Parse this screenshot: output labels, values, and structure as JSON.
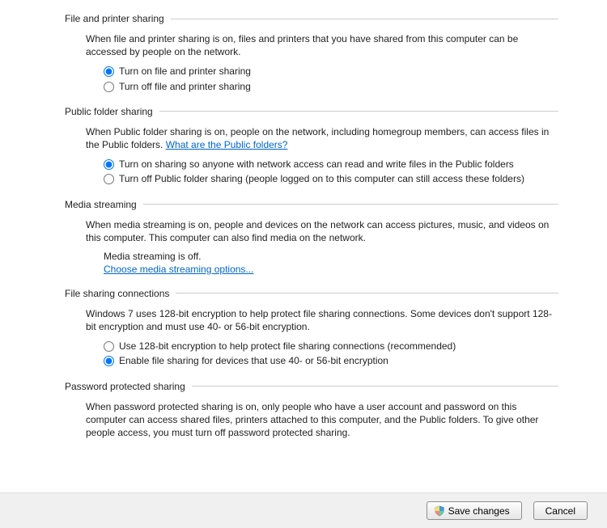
{
  "sections": {
    "filePrinter": {
      "title": "File and printer sharing",
      "desc": "When file and printer sharing is on, files and printers that you have shared from this computer can be accessed by people on the network.",
      "optOn": "Turn on file and printer sharing",
      "optOff": "Turn off file and printer sharing"
    },
    "publicFolder": {
      "title": "Public folder sharing",
      "descPre": "When Public folder sharing is on, people on the network, including homegroup members, can access files in the Public folders. ",
      "link": "What are the Public folders?",
      "optOn": "Turn on sharing so anyone with network access can read and write files in the Public folders",
      "optOff": "Turn off Public folder sharing (people logged on to this computer can still access these folders)"
    },
    "media": {
      "title": "Media streaming",
      "desc": "When media streaming is on, people and devices on the network can access pictures, music, and videos on this computer. This computer can also find media on the network.",
      "status": "Media streaming is off.",
      "link": "Choose media streaming options..."
    },
    "fileConn": {
      "title": "File sharing connections",
      "desc": "Windows 7 uses 128-bit encryption to help protect file sharing connections. Some devices don't support 128-bit encryption and must use 40- or 56-bit encryption.",
      "opt128": "Use 128-bit encryption to help protect file sharing connections (recommended)",
      "opt40": "Enable file sharing for devices that use 40- or 56-bit encryption"
    },
    "password": {
      "title": "Password protected sharing",
      "desc": "When password protected sharing is on, only people who have a user account and password on this computer can access shared files, printers attached to this computer, and the Public folders. To give other people access, you must turn off password protected sharing."
    }
  },
  "footer": {
    "save": "Save changes",
    "cancel": "Cancel"
  }
}
